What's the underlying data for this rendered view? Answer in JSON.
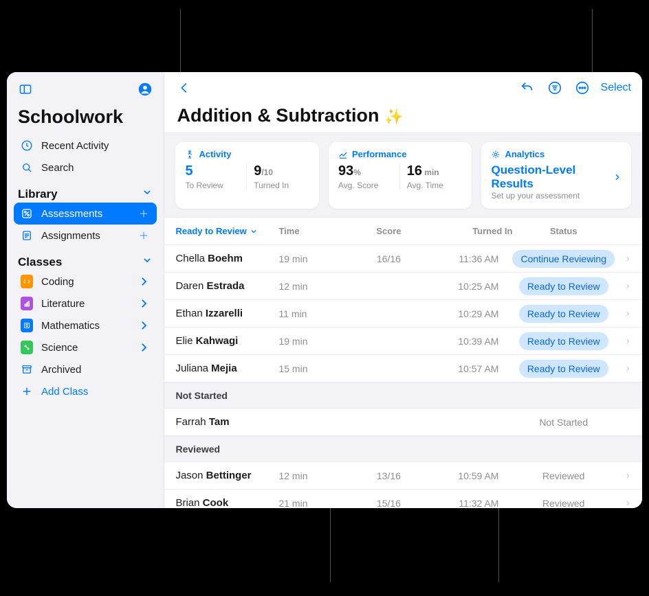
{
  "meta": {
    "icons": {}
  },
  "sidebar": {
    "appTitle": "Schoolwork",
    "recentActivity": "Recent Activity",
    "search": "Search",
    "library": "Library",
    "assessments": "Assessments",
    "assignments": "Assignments",
    "classesHeader": "Classes",
    "classes": [
      {
        "label": "Coding",
        "colorClass": "ic-color-orange"
      },
      {
        "label": "Literature",
        "colorClass": "ic-color-purple"
      },
      {
        "label": "Mathematics",
        "colorClass": "ic-color-blue"
      },
      {
        "label": "Science",
        "colorClass": "ic-color-green"
      }
    ],
    "archived": "Archived",
    "addClass": "Add Class"
  },
  "header": {
    "title": "Addition & Subtraction",
    "sparkle": "✨",
    "select": "Select"
  },
  "cards": {
    "activity": {
      "title": "Activity",
      "toReview": {
        "value": "5",
        "label": "To Review"
      },
      "turnedIn": {
        "value": "9",
        "of": "/10",
        "label": "Turned In"
      }
    },
    "performance": {
      "title": "Performance",
      "avgScore": {
        "value": "93",
        "unit": "%",
        "label": "Avg. Score"
      },
      "avgTime": {
        "value": "16",
        "unit": " min",
        "label": "Avg. Time"
      }
    },
    "analytics": {
      "title": "Analytics",
      "link": "Question-Level Results",
      "sub": "Set up your assessment"
    }
  },
  "table": {
    "columns": {
      "ready": "Ready to Review",
      "time": "Time",
      "score": "Score",
      "turnedIn": "Turned In",
      "status": "Status"
    },
    "sections": {
      "notStarted": "Not Started",
      "reviewed": "Reviewed"
    },
    "rowsReady": [
      {
        "first": "Chella",
        "last": "Boehm",
        "time": "19 min",
        "score": "16/16",
        "turnedIn": "11:36 AM",
        "status": "Continue Reviewing"
      },
      {
        "first": "Daren",
        "last": "Estrada",
        "time": "12 min",
        "score": "",
        "turnedIn": "10:25 AM",
        "status": "Ready to Review"
      },
      {
        "first": "Ethan",
        "last": "Izzarelli",
        "time": "11 min",
        "score": "",
        "turnedIn": "10:29 AM",
        "status": "Ready to Review"
      },
      {
        "first": "Elie",
        "last": "Kahwagi",
        "time": "19 min",
        "score": "",
        "turnedIn": "10:39 AM",
        "status": "Ready to Review"
      },
      {
        "first": "Juliana",
        "last": "Mejia",
        "time": "15 min",
        "score": "",
        "turnedIn": "10:57 AM",
        "status": "Ready to Review"
      }
    ],
    "rowsNotStarted": [
      {
        "first": "Farrah",
        "last": "Tam",
        "time": "",
        "score": "",
        "turnedIn": "",
        "status": "Not Started"
      }
    ],
    "rowsReviewed": [
      {
        "first": "Jason",
        "last": "Bettinger",
        "time": "12 min",
        "score": "13/16",
        "turnedIn": "10:59 AM",
        "status": "Reviewed"
      },
      {
        "first": "Brian",
        "last": "Cook",
        "time": "21 min",
        "score": "15/16",
        "turnedIn": "11:32 AM",
        "status": "Reviewed"
      }
    ]
  }
}
